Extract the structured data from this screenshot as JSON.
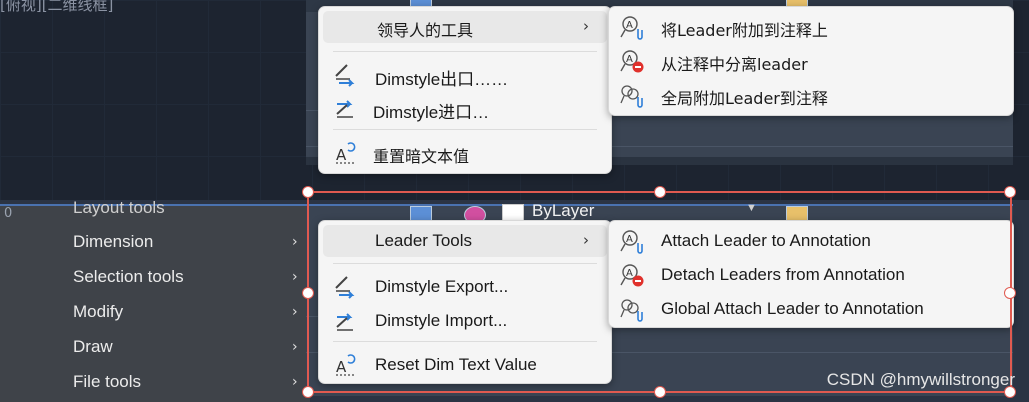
{
  "viewport": {
    "view_label": "[俯视][二维线框]"
  },
  "top_context_menu": {
    "items": [
      {
        "label": "领导人的工具",
        "has_submenu": true
      },
      {
        "label": "Dimstyle出口……",
        "icon": "dimstyle-export-icon"
      },
      {
        "label": "Dimstyle进口…",
        "icon": "dimstyle-import-icon"
      },
      {
        "label": "重置暗文本值",
        "icon": "reset-dim-text-icon"
      }
    ]
  },
  "top_submenu": {
    "items": [
      {
        "label": "将Leader附加到注释上",
        "icon": "attach-leader-icon"
      },
      {
        "label": "从注释中分离leader",
        "icon": "detach-leader-icon"
      },
      {
        "label": "全局附加Leader到注释",
        "icon": "global-attach-leader-icon"
      }
    ]
  },
  "side_menu": {
    "items": [
      {
        "label": "Layout tools"
      },
      {
        "label": "Dimension"
      },
      {
        "label": "Selection tools"
      },
      {
        "label": "Modify"
      },
      {
        "label": "Draw"
      },
      {
        "label": "File tools"
      }
    ]
  },
  "toolbar": {
    "layer_value": "ByLayer"
  },
  "bottom_context_menu": {
    "items": [
      {
        "label": "Leader Tools",
        "has_submenu": true
      },
      {
        "label": "Dimstyle Export...",
        "icon": "dimstyle-export-icon"
      },
      {
        "label": "Dimstyle Import...",
        "icon": "dimstyle-import-icon"
      },
      {
        "label": "Reset Dim Text Value",
        "icon": "reset-dim-text-icon"
      }
    ]
  },
  "bottom_submenu": {
    "items": [
      {
        "label": "Attach Leader to Annotation",
        "icon": "attach-leader-icon"
      },
      {
        "label": "Detach Leaders from Annotation",
        "icon": "detach-leader-icon"
      },
      {
        "label": "Global Attach Leader to Annotation",
        "icon": "global-attach-leader-icon"
      }
    ]
  },
  "watermark": "CSDN @hmywillstronger",
  "colors": {
    "selection": "#e05a50",
    "accent_blue": "#2f7fd8",
    "detach_red": "#e0312c"
  }
}
